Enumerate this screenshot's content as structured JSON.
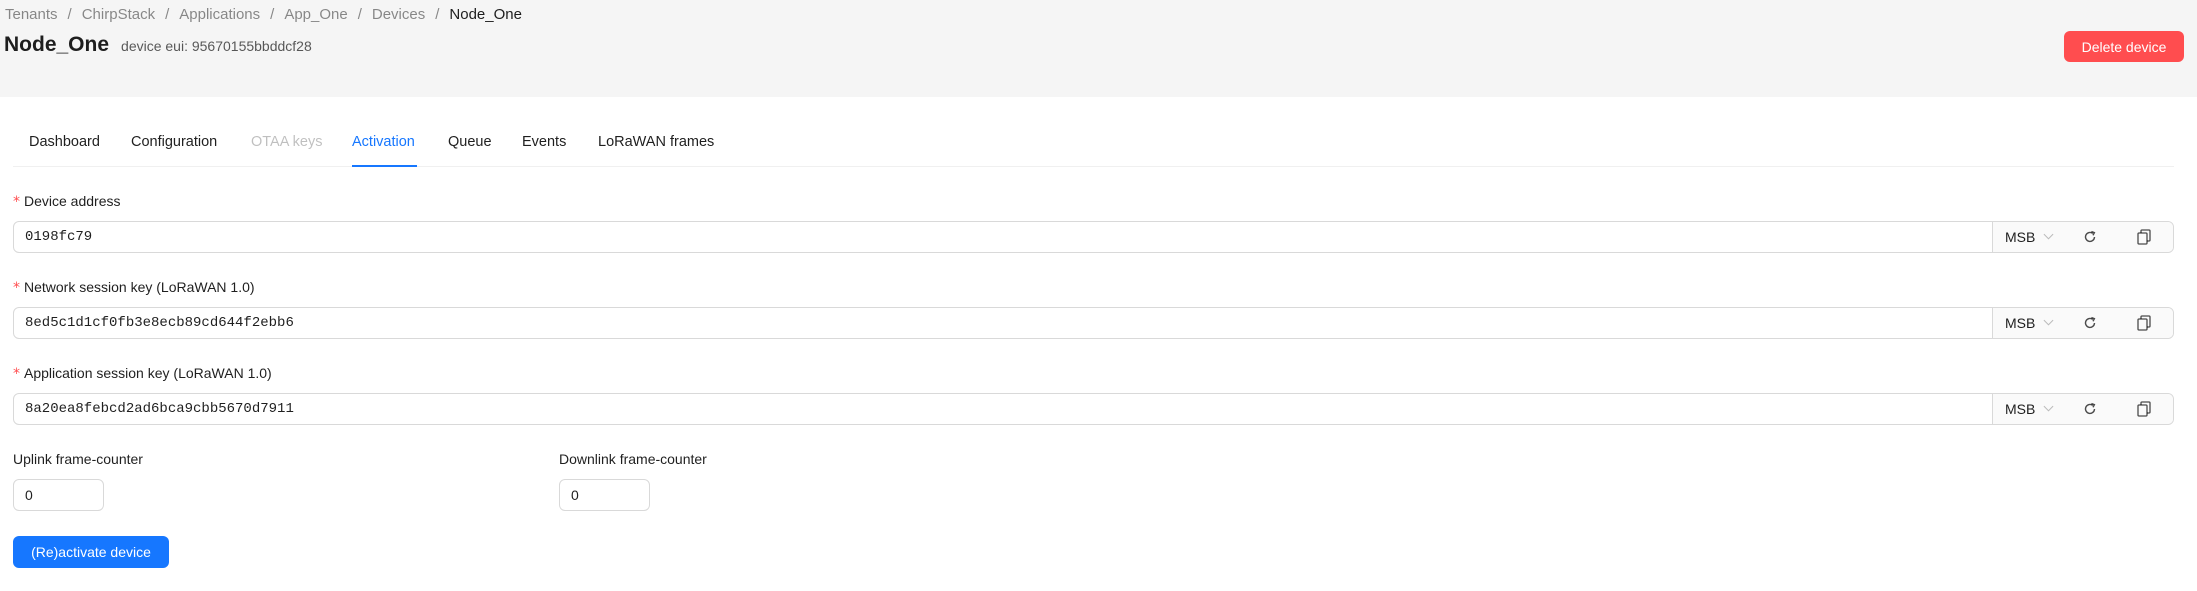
{
  "breadcrumb": {
    "items": [
      "Tenants",
      "ChirpStack",
      "Applications",
      "App_One",
      "Devices"
    ],
    "current": "Node_One",
    "separator": "/"
  },
  "header": {
    "title": "Node_One",
    "subtitle": "device eui: 95670155bbddcf28",
    "delete_label": "Delete device"
  },
  "tabs": [
    {
      "label": "Dashboard",
      "state": "normal"
    },
    {
      "label": "Configuration",
      "state": "normal"
    },
    {
      "label": "OTAA keys",
      "state": "disabled"
    },
    {
      "label": "Activation",
      "state": "active"
    },
    {
      "label": "Queue",
      "state": "normal"
    },
    {
      "label": "Events",
      "state": "normal"
    },
    {
      "label": "LoRaWAN frames",
      "state": "normal"
    }
  ],
  "form": {
    "required_mark": "*",
    "device_address": {
      "label": "Device address",
      "value": "0198fc79",
      "byte_order": "MSB"
    },
    "nwk_s_key": {
      "label": "Network session key (LoRaWAN 1.0)",
      "value": "8ed5c1d1cf0fb3e8ecb89cd644f2ebb6",
      "byte_order": "MSB"
    },
    "app_s_key": {
      "label": "Application session key (LoRaWAN 1.0)",
      "value": "8a20ea8febcd2ad6bca9cbb5670d7911",
      "byte_order": "MSB"
    },
    "uplink_fcnt": {
      "label": "Uplink frame-counter",
      "value": "0"
    },
    "downlink_fcnt": {
      "label": "Downlink frame-counter",
      "value": "0"
    },
    "submit_label": "(Re)activate device"
  },
  "icons": {
    "refresh": "refresh-icon",
    "copy": "copy-icon",
    "chevron": "chevron-down-icon"
  },
  "colors": {
    "primary": "#1677ff",
    "danger": "#ff4d4f",
    "header_bg": "#f5f5f5",
    "border": "#d9d9d9"
  }
}
